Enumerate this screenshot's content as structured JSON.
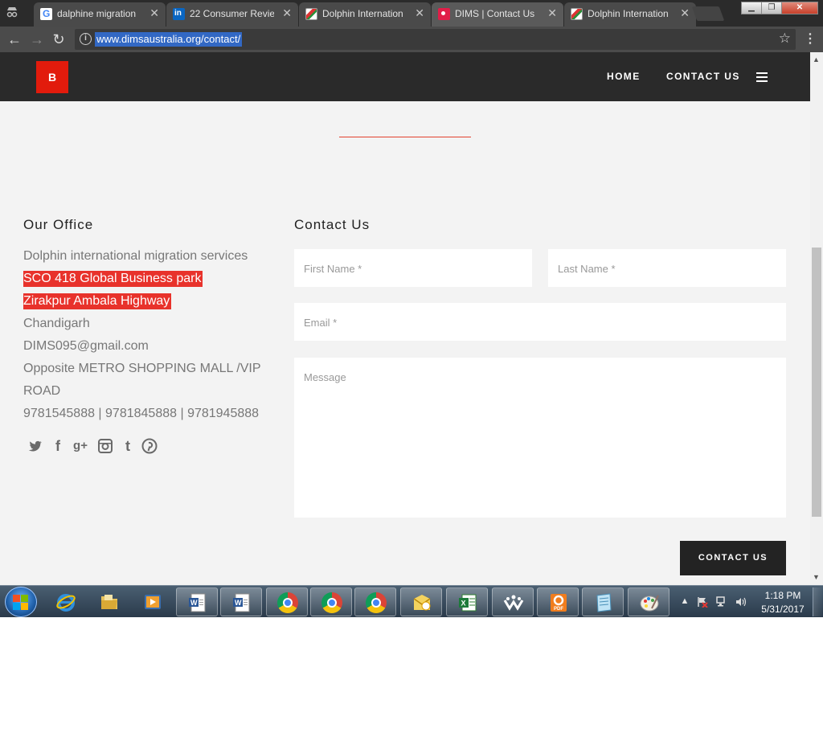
{
  "browser": {
    "tabs": [
      {
        "title": "dalphine migration",
        "favicon": "google-icon"
      },
      {
        "title": "22 Consumer Revie",
        "favicon": "linkedin-icon"
      },
      {
        "title": "Dolphin Internation",
        "favicon": "dolphin-flag-icon"
      },
      {
        "title": "DIMS | Contact Us",
        "favicon": "dims-icon",
        "active": true
      },
      {
        "title": "Dolphin Internation",
        "favicon": "dolphin-flag-icon"
      }
    ],
    "url": "www.dimsaustralia.org/contact/"
  },
  "site": {
    "logo": "B",
    "nav": {
      "home": "HOME",
      "contact": "CONTACT US"
    },
    "accent_color": "#e21b0c"
  },
  "office": {
    "heading": "Our Office",
    "lines": [
      "Dolphin international migration services",
      "SCO 418 Global Business park",
      "Zirakpur Ambala Highway",
      "Chandigarh",
      "DIMS095@gmail.com",
      "Opposite METRO SHOPPING MALL /VIP",
      "ROAD",
      "9781545888 | 9781845888 | 9781945888"
    ],
    "social": [
      "twitter-icon",
      "facebook-icon",
      "google-plus-icon",
      "instagram-icon",
      "tumblr-icon",
      "pinterest-icon"
    ]
  },
  "contact": {
    "heading": "Contact Us",
    "first_name_ph": "First Name *",
    "last_name_ph": "Last Name *",
    "email_ph": "Email *",
    "message_ph": "Message",
    "submit": "CONTACT US"
  },
  "taskbar": {
    "time": "1:18 PM",
    "date": "5/31/2017"
  }
}
